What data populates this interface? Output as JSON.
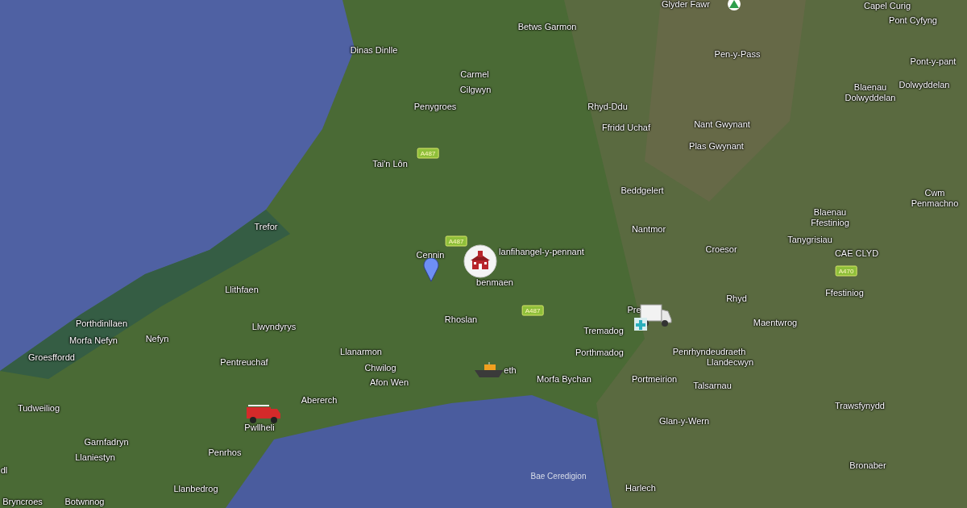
{
  "map": {
    "places": [
      {
        "name": "Glyder Fawr"
      },
      {
        "name": "Capel Curig"
      },
      {
        "name": "Pont Cyfyng"
      },
      {
        "name": "Betws Garmon"
      },
      {
        "name": "Dinas Dinlle"
      },
      {
        "name": "Pen-y-Pass"
      },
      {
        "name": "Carmel"
      },
      {
        "name": "Cilgwyn"
      },
      {
        "name": "Pont-y-pant"
      },
      {
        "name": "Penygroes"
      },
      {
        "name": "Rhyd-Ddu"
      },
      {
        "name": "Blaenau Dolwyddelan"
      },
      {
        "name": "Dolwyddelan"
      },
      {
        "name": "Ffridd Uchaf"
      },
      {
        "name": "Nant Gwynant"
      },
      {
        "name": "Plas Gwynant"
      },
      {
        "name": "Tai'n Lôn"
      },
      {
        "name": "Beddgelert"
      },
      {
        "name": "Cwm Penmachno"
      },
      {
        "name": "Trefor"
      },
      {
        "name": "Nantmor"
      },
      {
        "name": "Blaenau Ffestiniog"
      },
      {
        "name": "Tanygrisiau"
      },
      {
        "name": "Cennin"
      },
      {
        "name": "lanfihangel-y-pennant"
      },
      {
        "name": "Croesor"
      },
      {
        "name": "CAE CLYD"
      },
      {
        "name": "benmaen"
      },
      {
        "name": "Llithfaen"
      },
      {
        "name": "Ffestiniog"
      },
      {
        "name": "Rhyd"
      },
      {
        "name": "Porthdinllaen"
      },
      {
        "name": "Rhoslan"
      },
      {
        "name": "Maentwrog"
      },
      {
        "name": "Pre"
      },
      {
        "name": "Morfa Nefyn"
      },
      {
        "name": "Nefyn"
      },
      {
        "name": "Llwyndyrys"
      },
      {
        "name": "Tremadog"
      },
      {
        "name": "Groesffordd"
      },
      {
        "name": "Llanarmon"
      },
      {
        "name": "Porthmadog"
      },
      {
        "name": "Penrhyndeudraeth"
      },
      {
        "name": "Pentreuchaf"
      },
      {
        "name": "Chwilog"
      },
      {
        "name": "Afon Wen"
      },
      {
        "name": "eth"
      },
      {
        "name": "Morfa Bychan"
      },
      {
        "name": "Portmeirion"
      },
      {
        "name": "Llandecwyn"
      },
      {
        "name": "Talsarnau"
      },
      {
        "name": "Abererch"
      },
      {
        "name": "Trawsfynydd"
      },
      {
        "name": "Tudweiliog"
      },
      {
        "name": "Pwllheli"
      },
      {
        "name": "Glan-y-Wern"
      },
      {
        "name": "Garnfadryn"
      },
      {
        "name": "Llaniestyn"
      },
      {
        "name": "Penrhos"
      },
      {
        "name": "Bronaber"
      },
      {
        "name": "dl"
      },
      {
        "name": "Llanbedrog"
      },
      {
        "name": "Harlech"
      },
      {
        "name": "Bryncroes"
      },
      {
        "name": "Botwnnog"
      }
    ],
    "water_labels": [
      "Bae Ceredigion"
    ],
    "road_shields": [
      "A487",
      "A487",
      "A487",
      "A470"
    ],
    "markers": [
      {
        "kind": "peak"
      },
      {
        "kind": "pin"
      },
      {
        "kind": "school"
      },
      {
        "kind": "ambulance"
      },
      {
        "kind": "boat"
      },
      {
        "kind": "fire-truck"
      }
    ]
  }
}
